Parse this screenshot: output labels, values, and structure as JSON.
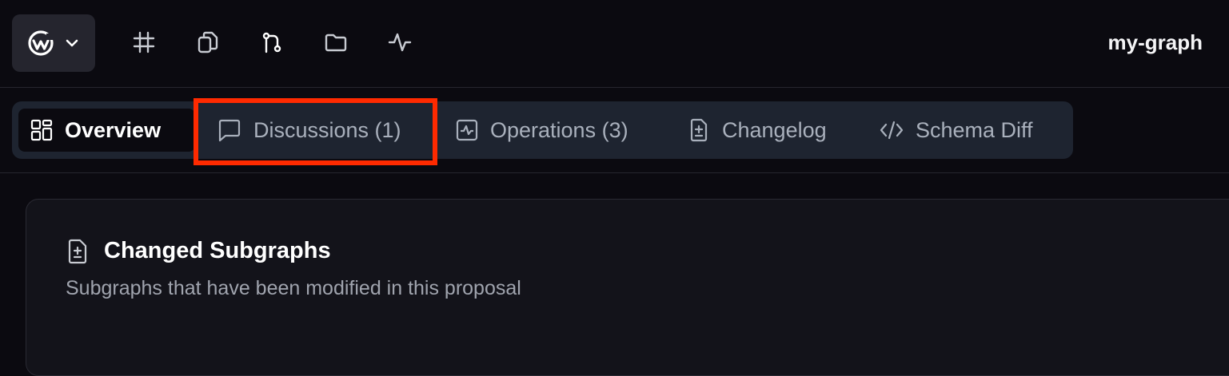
{
  "header": {
    "graph_name": "my-graph",
    "logo_icon": "wundergraph-logo-icon",
    "nav_icons": [
      "hash-icon",
      "copy-icon",
      "git-branch-icon",
      "folder-icon",
      "activity-icon"
    ]
  },
  "tabs": [
    {
      "label": "Overview",
      "icon": "grid-icon",
      "active": true
    },
    {
      "label": "Discussions (1)",
      "icon": "message-square-icon",
      "active": false
    },
    {
      "label": "Operations (3)",
      "icon": "activity-square-icon",
      "active": false
    },
    {
      "label": "Changelog",
      "icon": "file-diff-icon",
      "active": false
    },
    {
      "label": "Schema Diff",
      "icon": "code-icon",
      "active": false
    }
  ],
  "card": {
    "title": "Changed Subgraphs",
    "subtitle": "Subgraphs that have been modified in this proposal"
  },
  "colors": {
    "background": "#0b0a10",
    "tabbar": "#1e2430",
    "highlight": "#ff2a00"
  }
}
